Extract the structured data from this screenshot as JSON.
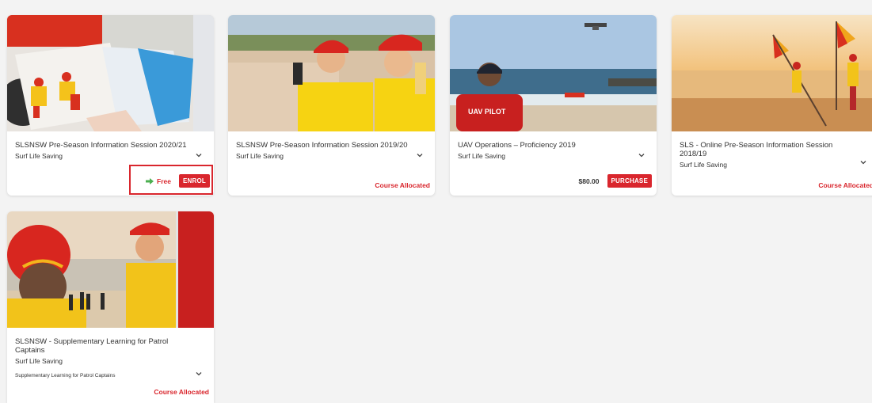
{
  "cards": [
    {
      "title": "SLSNSW Pre-Season Information Session 2020/21",
      "org": "Surf Life Saving",
      "free_label": "Free",
      "enrol_label": "ENROL"
    },
    {
      "title": "SLSNSW Pre-Season Information Session 2019/20",
      "org": "Surf Life Saving",
      "status": "Course Allocated"
    },
    {
      "title": "UAV Operations – Proficiency 2019",
      "org": "Surf Life Saving",
      "price": "$80.00",
      "purchase_label": "PURCHASE",
      "shirt_text": "UAV PILOT"
    },
    {
      "title": "SLS - Online Pre-Season Information Session 2018/19",
      "org": "Surf Life Saving",
      "status": "Course Allocated"
    },
    {
      "title": "SLSNSW - Supplementary Learning for Patrol Captains",
      "org": "Surf Life Saving",
      "description": "Supplementary Learning for Patrol Captains",
      "status": "Course Allocated"
    }
  ],
  "colors": {
    "accent_red": "#d9262d",
    "free_icon_green": "#4caf50",
    "page_bg": "#f3f3f3"
  },
  "icons": {
    "expand": "chevron-down-icon",
    "free": "arrow-right-icon"
  }
}
